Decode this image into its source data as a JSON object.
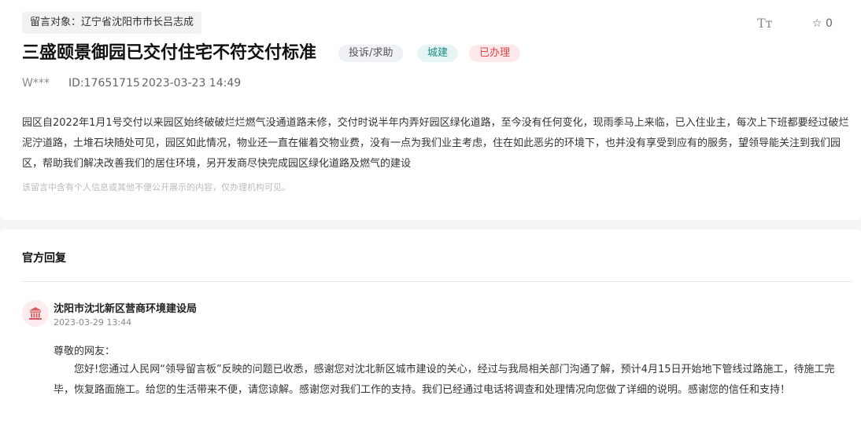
{
  "message": {
    "target_label": "留言对象：辽宁省沈阳市市长吕志成",
    "font_size_label": "Tт",
    "favorite_icon": "star-outline-icon",
    "favorite_count": "☆ 0",
    "title": "三盛颐景御园已交付住宅不符交付标准",
    "badges": {
      "type": "投诉/求助",
      "field": "城建",
      "status": "已办理"
    },
    "user": "W***",
    "id": "ID:17651715",
    "date": "2023-03-23 14:49",
    "content": "园区自2022年1月1号交付以来园区始终破破烂烂燃气没通道路未修，交付时说半年内弄好园区绿化道路，至今没有任何变化，现雨季马上来临，已入住业主，每次上下班都要经过破烂泥泞道路，土堆石块随处可见，园区如此情况，物业还一直在催着交物业费，没有一点为我们业主考虑，住在如此恶劣的环境下，也并没有享受到应有的服务，望领导能关注到我们园区，帮助我们解决改善我们的居住环境，另开发商尽快完成园区绿化道路及燃气的建设",
    "privacy_notice": "该留言中含有个人信息或其他不便公开展示的内容，仅办理机构可见。"
  },
  "reply": {
    "heading": "官方回复",
    "org_icon": "government-building-icon",
    "org_name": "沈阳市沈北新区营商环境建设局",
    "date": "2023-03-29 13:44",
    "greeting": "尊敬的网友：",
    "body": "您好!您通过人民网“领导留言板”反映的问题已收悉，感谢您对沈北新区城市建设的关心，经过与我局相关部门沟通了解，预计4月15日开始地下管线过路施工，待施工完毕，恢复路面施工。给您的生活带来不便，请您谅解。感谢您对我们工作的支持。我们已经通过电话将调查和处理情况向您做了详细的说明。感谢您的信任和支持！"
  },
  "colors": {
    "status_red": "#e04347",
    "field_teal": "#1a8a86",
    "avatar_bg": "#fdeced",
    "avatar_icon": "#d85c5f"
  }
}
